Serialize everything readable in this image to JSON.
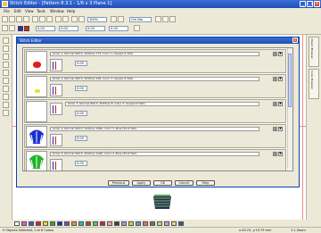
{
  "window": {
    "title": "Stitch Editor - [Pattern 8.3.1 - 1/6 x 3 Plane 1]",
    "min_label": "_",
    "max_label": "□",
    "close_label": "x"
  },
  "menu": [
    "File",
    "Edit",
    "View",
    "Tools",
    "Window",
    "Help"
  ],
  "toolbar": {
    "zoom_value": "100%",
    "font_value": "Ctrl Bar",
    "value_a": "0.00",
    "value_b": "0.00",
    "value_c": "0.00",
    "value_d": "0.00"
  },
  "dialog": {
    "title": "Stitch Editor",
    "rows": [
      {
        "desc": "Order 1, Normal Stitch, Stitches 773, Color 1, Save(0.0°0x0)",
        "value": "0.00",
        "motif": "red-blob"
      },
      {
        "desc": "Order 2, Normal Stitch, Stitches 295, Color 3, Save(0.0°0x0)",
        "value": "0.00",
        "motif": "yellow-dot"
      },
      {
        "desc": "Order 3, Normal Stitch, Stitches 8, Color 3, Save(0.0°0x0)",
        "value": "0.00",
        "motif": "empty"
      },
      {
        "desc": "Order 4, Normal Stitch, Stitches 3040, Color 3, Blue (50.0°0x0)",
        "value": "0.00",
        "motif": "blue-shell"
      },
      {
        "desc": "Order 5, Normal Stitch, Stitches 2040, Color 4, Blue (50.0°0x0)",
        "value": "0.00",
        "motif": "green-shell"
      }
    ],
    "buttons": {
      "prev": "Previous",
      "apply": "Apply",
      "ok": "OK",
      "cancel": "Cancel",
      "help": "Help"
    }
  },
  "status": {
    "left": "0 Objects Selected, 1 of 8 Colors",
    "coords": "x:49.23, y:15.79 mm",
    "right": "1:1 Zoom"
  },
  "right_tabs": [
    "Object Browser",
    "Color Browser"
  ],
  "colors": {
    "accent": "#2a5fcf",
    "red": "#e02020",
    "yellow": "#f0e030",
    "blue": "#1a2fd0",
    "green": "#22b22a"
  }
}
